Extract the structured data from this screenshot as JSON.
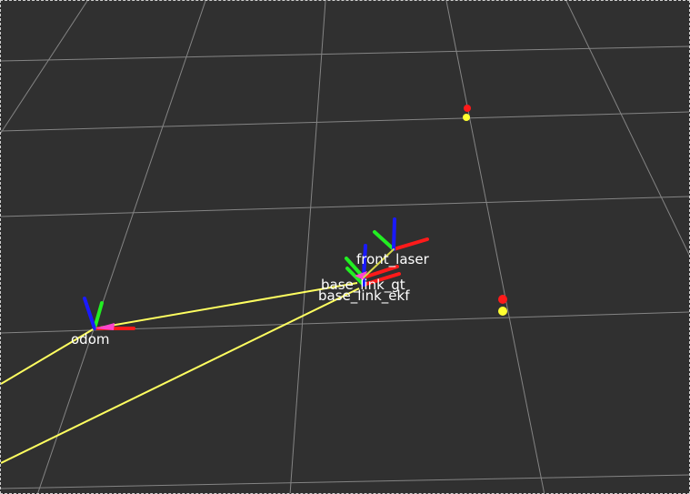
{
  "view": {
    "background": "#303030",
    "grid_color": "#a0a0a0",
    "path_color": "#ffff60"
  },
  "axis_colors": {
    "x": "#ff1a1a",
    "y": "#22ee22",
    "z": "#1a1aff"
  },
  "frames": [
    {
      "id": "odom",
      "label": "odom"
    },
    {
      "id": "front_laser",
      "label": "front_laser"
    },
    {
      "id": "base_link_gt",
      "label": "base_link_gt"
    },
    {
      "id": "base_link_ekf",
      "label": "base_link_ekf"
    }
  ],
  "markers": [
    {
      "name": "red-point-far",
      "color": "#ff1a1a"
    },
    {
      "name": "yellow-point-far",
      "color": "#ffff30"
    },
    {
      "name": "red-point-near",
      "color": "#ff1a1a"
    },
    {
      "name": "yellow-point-near",
      "color": "#ffff30"
    }
  ]
}
